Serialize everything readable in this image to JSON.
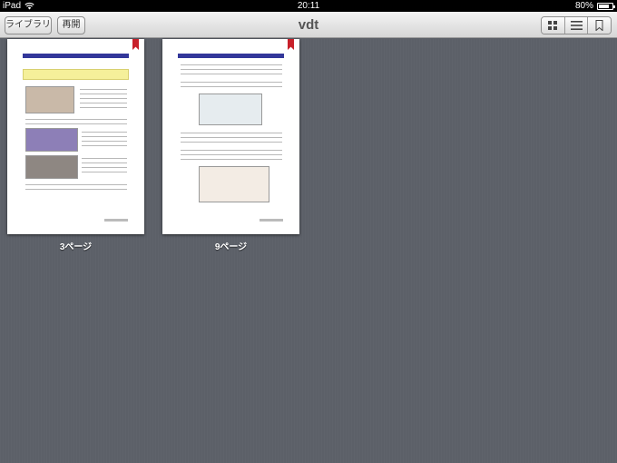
{
  "status_bar": {
    "carrier": "iPad",
    "time": "20:11",
    "battery_percent": "80%",
    "battery_level": 0.8
  },
  "toolbar": {
    "library_label": "ライブラリ",
    "resume_label": "再開",
    "title": "vdt",
    "view_modes": [
      {
        "icon": "grid-icon",
        "selected": true
      },
      {
        "icon": "list-icon",
        "selected": false
      },
      {
        "icon": "bookmark-icon",
        "selected": false
      }
    ]
  },
  "pages": [
    {
      "label": "3ページ",
      "bookmarked": true
    },
    {
      "label": "9ページ",
      "bookmarked": true
    }
  ],
  "colors": {
    "background": "#5a5e66",
    "bookmark": "#c8202a",
    "page_header": "#33379a"
  }
}
